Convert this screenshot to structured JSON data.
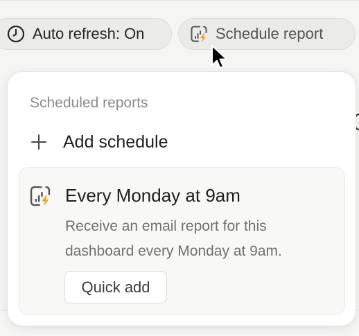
{
  "toolbar": {
    "auto_refresh_label": "Auto refresh: On",
    "auto_refresh_icon": "clock-icon",
    "schedule_report_label": "Schedule report",
    "schedule_report_icon": "report-lightning-icon"
  },
  "popover": {
    "heading": "Scheduled reports",
    "add_label": "Add schedule",
    "add_icon": "plus-icon",
    "suggestion": {
      "icon": "report-lightning-icon",
      "title": "Every Monday at 9am",
      "description": "Receive an email report for this dashboard every Monday at 9am.",
      "action_label": "Quick add"
    }
  },
  "colors": {
    "accent_bolt": "#f0a020",
    "text_primary": "#1f1f1f",
    "text_muted": "#707070"
  }
}
